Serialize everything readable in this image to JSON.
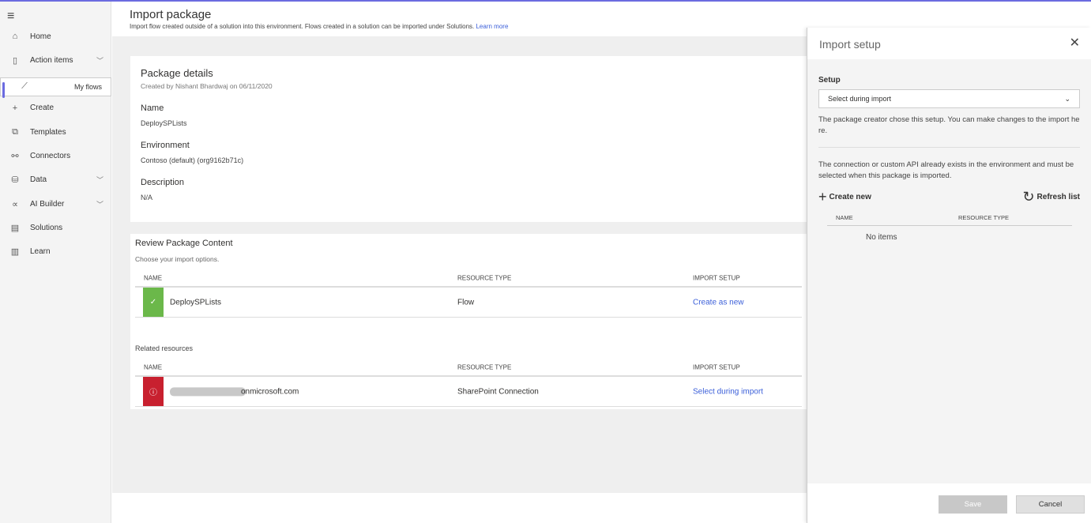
{
  "sidebar": {
    "items": [
      {
        "label": "Home",
        "icon": "home-icon",
        "glyph": "⌂"
      },
      {
        "label": "Action items",
        "icon": "clipboard-icon",
        "glyph": "▯",
        "chevron": true
      },
      {
        "label": "My flows",
        "icon": "flow-icon",
        "glyph": "⟋",
        "selected": true
      },
      {
        "label": "Create",
        "icon": "plus-icon",
        "glyph": "+"
      },
      {
        "label": "Templates",
        "icon": "templates-icon",
        "glyph": "⧉"
      },
      {
        "label": "Connectors",
        "icon": "connector-icon",
        "glyph": "⚯"
      },
      {
        "label": "Data",
        "icon": "database-icon",
        "glyph": "⛁",
        "chevron": true
      },
      {
        "label": "AI Builder",
        "icon": "ai-builder-icon",
        "glyph": "∝",
        "chevron": true
      },
      {
        "label": "Solutions",
        "icon": "solutions-icon",
        "glyph": "▤"
      },
      {
        "label": "Learn",
        "icon": "book-icon",
        "glyph": "▥"
      }
    ]
  },
  "header": {
    "title": "Import package",
    "subtitle": "Import flow created outside of a solution into this environment. Flows created in a solution can be imported under Solutions.",
    "learn_more": "Learn more"
  },
  "details": {
    "title": "Package details",
    "created": "Created by Nishant Bhardwaj on 06/11/2020",
    "name_label": "Name",
    "name": "DeploySPLists",
    "env_label": "Environment",
    "env": "Contoso (default) (org9162b71c)",
    "desc_label": "Description",
    "desc": "N/A"
  },
  "review": {
    "title": "Review Package Content",
    "subtitle": "Choose your import options.",
    "columns": [
      "NAME",
      "RESOURCE TYPE",
      "IMPORT SETUP"
    ],
    "rows": [
      {
        "name": "DeploySPLists",
        "type": "Flow",
        "setup": "Create as new",
        "status": "success",
        "color": "#6bb84a"
      }
    ],
    "related_label": "Related resources",
    "related": [
      {
        "name": "onmicrosoft.com",
        "type": "SharePoint Connection",
        "setup": "Select during import",
        "status": "error",
        "color": "#c8202f"
      }
    ]
  },
  "panel": {
    "title": "Import setup",
    "setup_label": "Setup",
    "setup_value": "Select during import",
    "note": "The package creator chose this setup. You can make changes to the import here.",
    "info": "The connection or custom API already exists in the environment and must be selected when this package is imported.",
    "create_new": "Create new",
    "refresh": "Refresh list",
    "columns": [
      "NAME",
      "RESOURCE TYPE"
    ],
    "empty": "No items",
    "save": "Save",
    "cancel": "Cancel"
  }
}
